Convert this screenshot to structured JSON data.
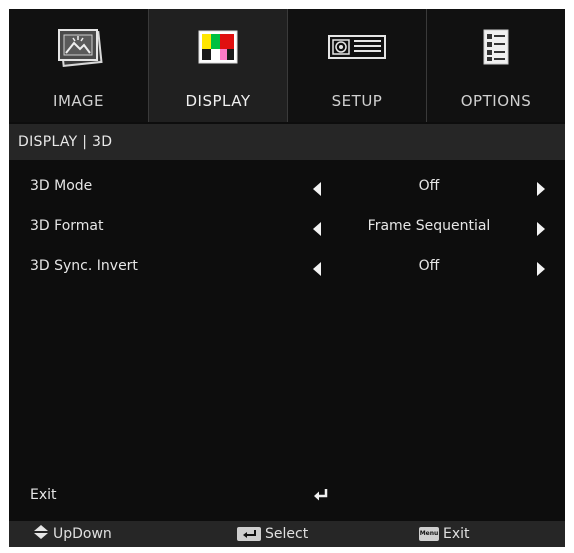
{
  "tabs": [
    {
      "label": "IMAGE",
      "icon": "image-icon",
      "active": false
    },
    {
      "label": "DISPLAY",
      "icon": "color-bars-icon",
      "active": true
    },
    {
      "label": "SETUP",
      "icon": "projector-icon",
      "active": false
    },
    {
      "label": "OPTIONS",
      "icon": "checklist-icon",
      "active": false
    }
  ],
  "breadcrumb": "DISPLAY  |  3D",
  "settings": [
    {
      "label": "3D Mode",
      "value": "Off"
    },
    {
      "label": "3D Format",
      "value": "Frame Sequential"
    },
    {
      "label": "3D Sync. Invert",
      "value": "Off"
    }
  ],
  "exit": {
    "label": "Exit",
    "icon": "enter-icon"
  },
  "footer": {
    "updown_label": "UpDown",
    "select_label": "Select",
    "menu_key": "Menu",
    "exit_label": "Exit"
  },
  "colors": {
    "background": "#0d0d0d",
    "bar": "#262626",
    "active_tab": "#202020",
    "text": "#e6e6e6"
  }
}
